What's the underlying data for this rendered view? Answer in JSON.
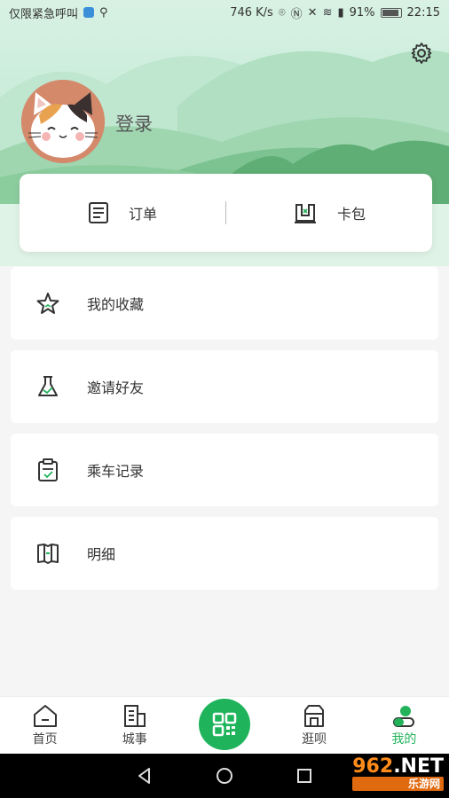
{
  "status_bar": {
    "left_text": "仅限紧急呼叫",
    "speed": "746 K/s",
    "battery": "91%",
    "battery_level": 0.91,
    "time": "22:15"
  },
  "header": {
    "login_label": "登录"
  },
  "card": {
    "orders_label": "订单",
    "wallet_label": "卡包"
  },
  "menu": [
    {
      "label": "我的收藏",
      "icon": "star-icon"
    },
    {
      "label": "邀请好友",
      "icon": "flask-icon"
    },
    {
      "label": "乘车记录",
      "icon": "clipboard-icon"
    },
    {
      "label": "明细",
      "icon": "book-icon"
    }
  ],
  "bottom_nav": {
    "home": "首页",
    "city": "城事",
    "shop": "逛呗",
    "mine": "我的"
  },
  "colors": {
    "accent": "#22b35a",
    "icon": "#333333"
  },
  "watermark": {
    "num": "962",
    "net": ".NET",
    "sub": "乐游网"
  }
}
